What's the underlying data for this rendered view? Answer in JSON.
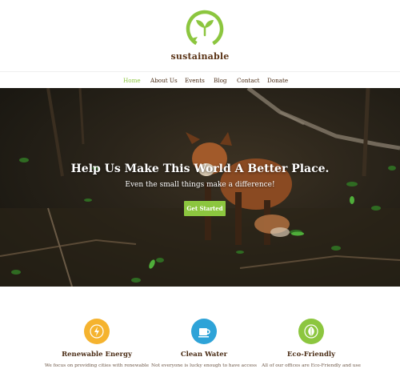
{
  "brand": {
    "name": "sustainable",
    "accent": "#8cc63f",
    "text_color": "#4a2c15"
  },
  "nav": {
    "items": [
      {
        "label": "Home",
        "active": true
      },
      {
        "label": "About Us",
        "active": false
      },
      {
        "label": "Events",
        "active": false
      },
      {
        "label": "Blog",
        "active": false
      },
      {
        "label": "Contact",
        "active": false
      },
      {
        "label": "Donate",
        "active": false
      }
    ]
  },
  "hero": {
    "title": "Help Us Make This World A Better Place.",
    "subtitle": "Even the small things make a difference!",
    "cta_label": "Get Started"
  },
  "features": [
    {
      "title": "Renewable Energy",
      "desc": "We focus on providing cities with renewable",
      "icon": "lightning-icon",
      "color": "#f5b32f"
    },
    {
      "title": "Clean Water",
      "desc": "Not everyone is lucky enough to have access",
      "icon": "cup-icon",
      "color": "#2ea3d8"
    },
    {
      "title": "Eco-Friendly",
      "desc": "All of our offices are Eco-Friendly and use",
      "icon": "leaf-icon",
      "color": "#8cc63f"
    }
  ]
}
